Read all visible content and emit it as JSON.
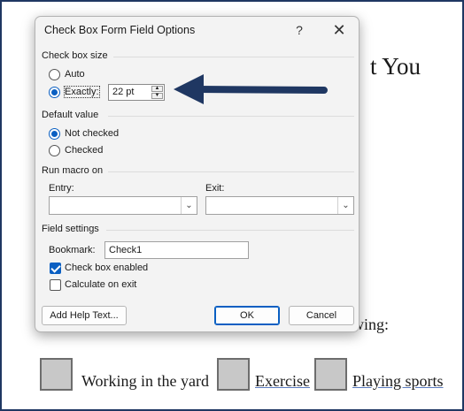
{
  "document": {
    "title_fragment": "t You",
    "line_fragment": "wing:",
    "options": [
      "Working in the yard",
      "Exercise",
      "Playing sports"
    ]
  },
  "dialog": {
    "title": "Check Box Form Field Options",
    "help_glyph": "?",
    "close_glyph": "✕",
    "size_group": {
      "label": "Check box size",
      "auto_label": "Auto",
      "exactly_label": "Exactly:",
      "selected": "exactly",
      "size_value": "22 pt"
    },
    "default_group": {
      "label": "Default value",
      "not_checked_label": "Not checked",
      "checked_label": "Checked",
      "selected": "not_checked"
    },
    "macro_group": {
      "label": "Run macro on",
      "entry_label": "Entry:",
      "exit_label": "Exit:",
      "entry_value": "",
      "exit_value": ""
    },
    "field_group": {
      "label": "Field settings",
      "bookmark_label": "Bookmark:",
      "bookmark_value": "Check1",
      "enabled_label": "Check box enabled",
      "enabled_checked": true,
      "calculate_label": "Calculate on exit",
      "calculate_checked": false
    },
    "buttons": {
      "help_text": "Add Help Text...",
      "ok": "OK",
      "cancel": "Cancel"
    }
  },
  "colors": {
    "accent": "#0a5fc2",
    "arrow": "#1f3762",
    "frame": "#1f3762"
  }
}
